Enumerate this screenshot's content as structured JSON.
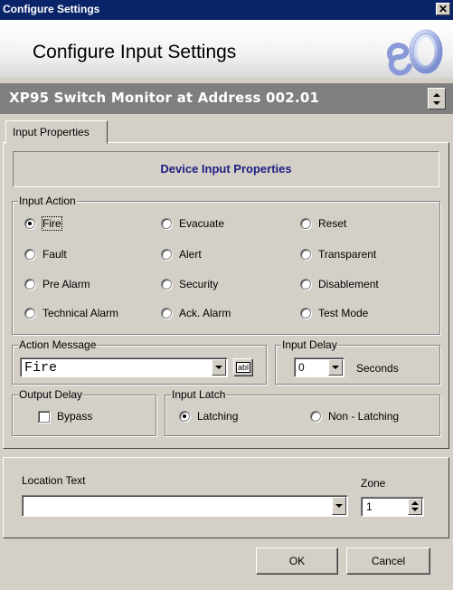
{
  "window": {
    "title": "Configure Settings",
    "close_label": "✕"
  },
  "header": {
    "title": "Configure Input Settings"
  },
  "device": {
    "name": "XP95 Switch Monitor at Address 002.01"
  },
  "tabs": [
    {
      "label": "Input Properties",
      "active": true
    }
  ],
  "panel": {
    "heading": "Device Input Properties"
  },
  "input_action": {
    "label": "Input Action",
    "options": [
      {
        "label": "Fire",
        "selected": true
      },
      {
        "label": "Evacuate",
        "selected": false
      },
      {
        "label": "Reset",
        "selected": false
      },
      {
        "label": "Fault",
        "selected": false
      },
      {
        "label": "Alert",
        "selected": false
      },
      {
        "label": "Transparent",
        "selected": false
      },
      {
        "label": "Pre Alarm",
        "selected": false
      },
      {
        "label": "Security",
        "selected": false
      },
      {
        "label": "Disablement",
        "selected": false
      },
      {
        "label": "Technical Alarm",
        "selected": false
      },
      {
        "label": "Ack. Alarm",
        "selected": false
      },
      {
        "label": "Test Mode",
        "selected": false
      }
    ]
  },
  "action_message": {
    "label": "Action Message",
    "value": "Fire",
    "edit_label": "abl"
  },
  "input_delay": {
    "label": "Input Delay",
    "value": "0",
    "unit": "Seconds"
  },
  "output_delay": {
    "label": "Output Delay",
    "bypass_label": "Bypass",
    "bypass_checked": false
  },
  "input_latch": {
    "label": "Input Latch",
    "latching_label": "Latching",
    "non_latching_label": "Non - Latching",
    "selected": "Latching"
  },
  "location": {
    "label": "Location Text",
    "value": ""
  },
  "zone": {
    "label": "Zone",
    "value": "1"
  },
  "buttons": {
    "ok": "OK",
    "cancel": "Cancel"
  },
  "colors": {
    "titlebar": "#0a246a",
    "device_bar": "#7f7f7f",
    "panel_heading": "#1e1e80",
    "face": "#d4d0c8"
  },
  "icons": [
    "close-icon",
    "logo-icon",
    "spinner-icon",
    "dropdown-arrow-icon"
  ]
}
